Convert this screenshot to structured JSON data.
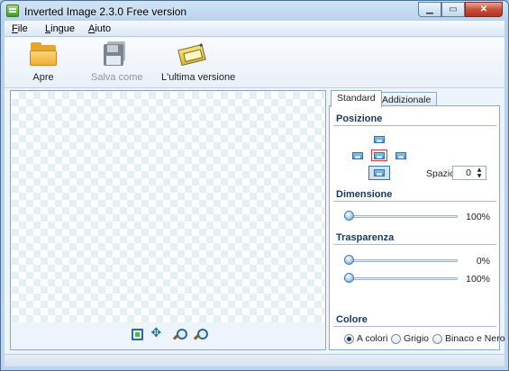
{
  "window": {
    "title": "Inverted Image 2.3.0 Free version"
  },
  "menu": [
    "File",
    "Lingue",
    "Aiuto"
  ],
  "toolbar": {
    "open_label": "Apre",
    "save_label": "Salva come",
    "update_label": "L'ultima versione"
  },
  "panel": {
    "tabs": [
      "Standard",
      "Addizionale"
    ],
    "position": {
      "title": "Posizione",
      "spazio_label": "Spazio",
      "spazio_value": "0"
    },
    "dimension": {
      "title": "Dimensione",
      "value_label": "100%",
      "value": 100
    },
    "transparency": {
      "title": "Trasparenza",
      "slider1_label": "0%",
      "slider1": 0,
      "slider2_label": "100%",
      "slider2": 100
    },
    "color": {
      "title": "Colore",
      "options": [
        "A colori",
        "Grigio",
        "Binaco e Nero"
      ],
      "selected": "A colori"
    }
  },
  "icons": {
    "open": "folder-icon",
    "save": "floppy-disk-icon",
    "update": "update-box-icon",
    "zoom": [
      "fit-to-window-icon",
      "move-icon",
      "zoom-in-icon",
      "zoom-out-icon"
    ]
  },
  "colors": {
    "section_title": "#17375e",
    "highlight_position": "#d23c2c",
    "window_frame": "#b9d2ec"
  }
}
